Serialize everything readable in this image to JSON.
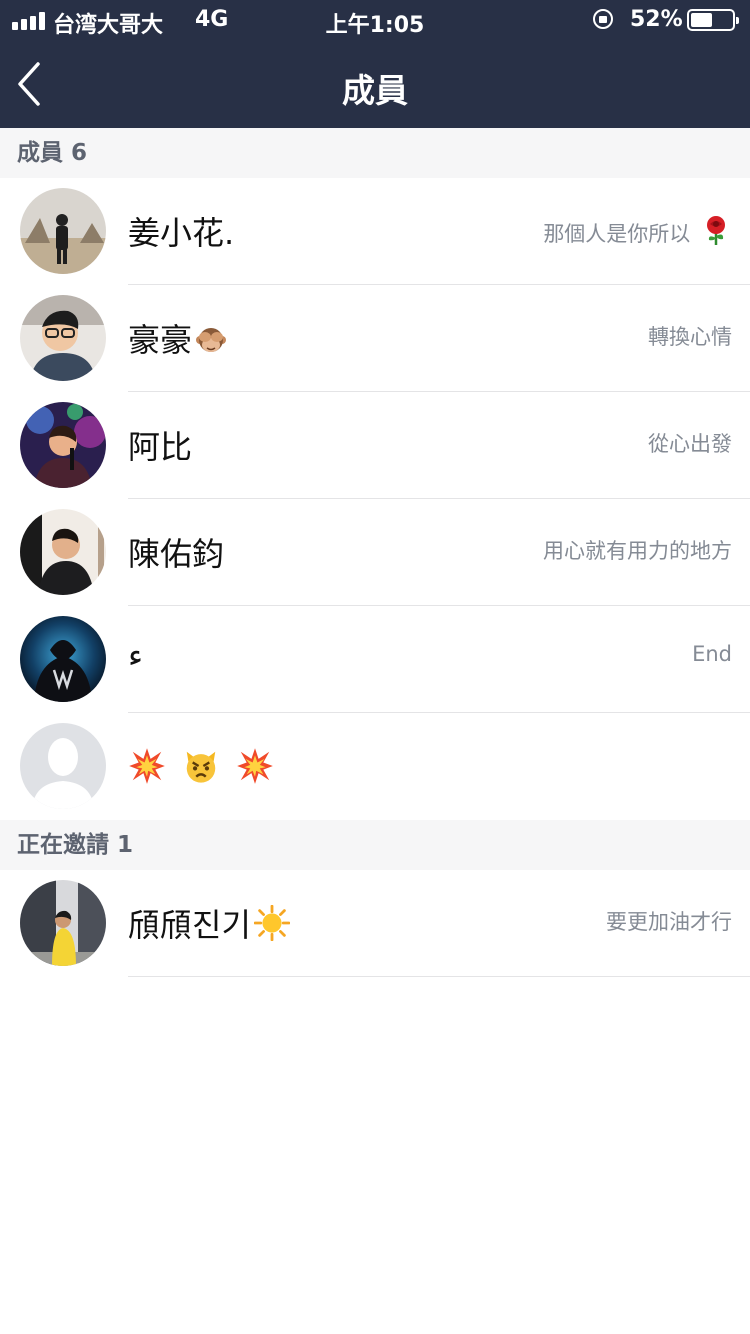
{
  "status_bar": {
    "carrier": "台湾大哥大",
    "network": "4G",
    "time": "上午1:05",
    "battery_percent_text": "52%",
    "battery_level": 0.52
  },
  "nav": {
    "title": "成員",
    "back_icon": "chevron-left-icon"
  },
  "members_section": {
    "header": "成員 6",
    "items": [
      {
        "name": "姜小花.",
        "status": "那個人是你所以",
        "status_emoji": "rose-emoji"
      },
      {
        "name": "豪豪",
        "name_emoji": "see-no-evil-monkey-emoji",
        "status": "轉換心情"
      },
      {
        "name": "阿比",
        "status": "從心出發"
      },
      {
        "name": "陳佑鈞",
        "status": "用心就有用力的地方"
      },
      {
        "name": "ء",
        "status": "End"
      },
      {
        "name": "",
        "name_emojis": [
          "collision-emoji",
          "pouting-cat-emoji",
          "collision-emoji"
        ],
        "status": "",
        "avatar": "default-avatar"
      }
    ]
  },
  "inviting_section": {
    "header": "正在邀請 1",
    "items": [
      {
        "name": "頎頎진기",
        "name_emoji": "sun-emoji",
        "status": "要更加油才行"
      }
    ]
  },
  "colors": {
    "nav_background": "#283046",
    "section_background": "#f6f6f7",
    "secondary_text": "#858b95",
    "divider": "#e4e4e6"
  }
}
